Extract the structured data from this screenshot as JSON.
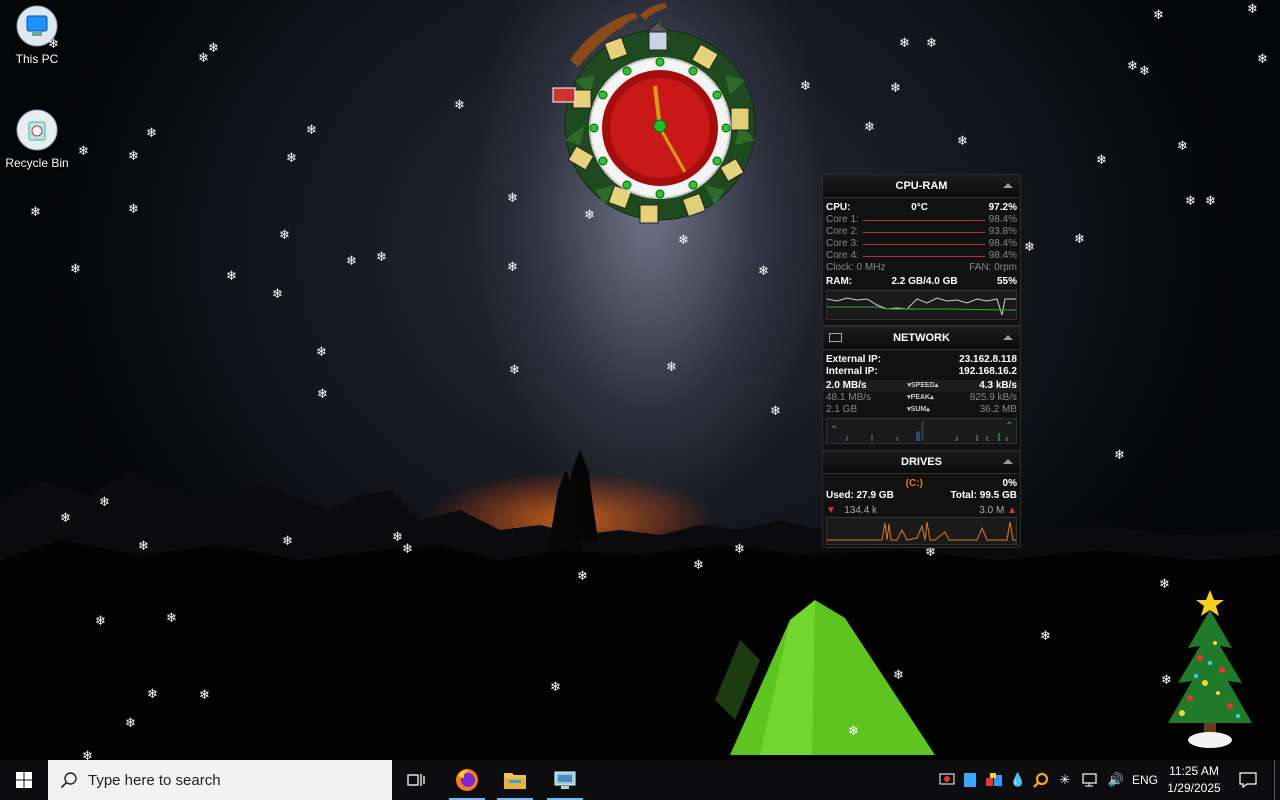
{
  "desktop": {
    "icons": [
      {
        "label": "This PC",
        "icon": "this-pc-icon"
      },
      {
        "label": "Recycle Bin",
        "icon": "recycle-bin-icon"
      }
    ]
  },
  "cpu_ram": {
    "title": "CPU-RAM",
    "cpu_label": "CPU:",
    "cpu_temp": "0°C",
    "cpu_usage": "97.2%",
    "cores": [
      {
        "label": "Core 1:",
        "value": "98.4%"
      },
      {
        "label": "Core 2:",
        "value": "93.8%"
      },
      {
        "label": "Core 3:",
        "value": "98.4%"
      },
      {
        "label": "Core 4:",
        "value": "98.4%"
      }
    ],
    "clock": "Clock: 0 MHz",
    "fan": "FAN: 0rpm",
    "ram_label": "RAM:",
    "ram_used": "2.2 GB/4.0 GB",
    "ram_percent": "55%"
  },
  "network": {
    "title": "NETWORK",
    "external_ip_label": "External IP:",
    "external_ip": "23.162.8.118",
    "internal_ip_label": "Internal IP:",
    "internal_ip": "192.168.16.2",
    "speed_down": "2.0 MB/s",
    "speed_label": "SPEED",
    "speed_up": "4.3 kB/s",
    "peak_down": "48.1 MB/s",
    "peak_label": "PEAK",
    "peak_up": "825.9 kB/s",
    "sum_down": "2.1 GB",
    "sum_label": "SUM",
    "sum_up": "36.2 MB"
  },
  "drives": {
    "title": "DRIVES",
    "drive": "(C:)",
    "percent": "0%",
    "used": "Used: 27.9 GB",
    "total": "Total: 99.5 GB",
    "read": "134.4 k",
    "write": "3.0 M"
  },
  "taskbar": {
    "search_placeholder": "Type here to search",
    "apps": [
      "task-view-icon",
      "firefox-icon",
      "file-explorer-icon",
      "control-panel-icon"
    ],
    "language": "ENG",
    "time": "11:25 AM",
    "date": "1/29/2025"
  },
  "colors": {
    "widget_bg": "#111111",
    "core_line": "#b33333",
    "taskbar_bg": "#0d0d0f",
    "search_bg": "#f2f2f2",
    "tent_green": "#6fd42a"
  }
}
